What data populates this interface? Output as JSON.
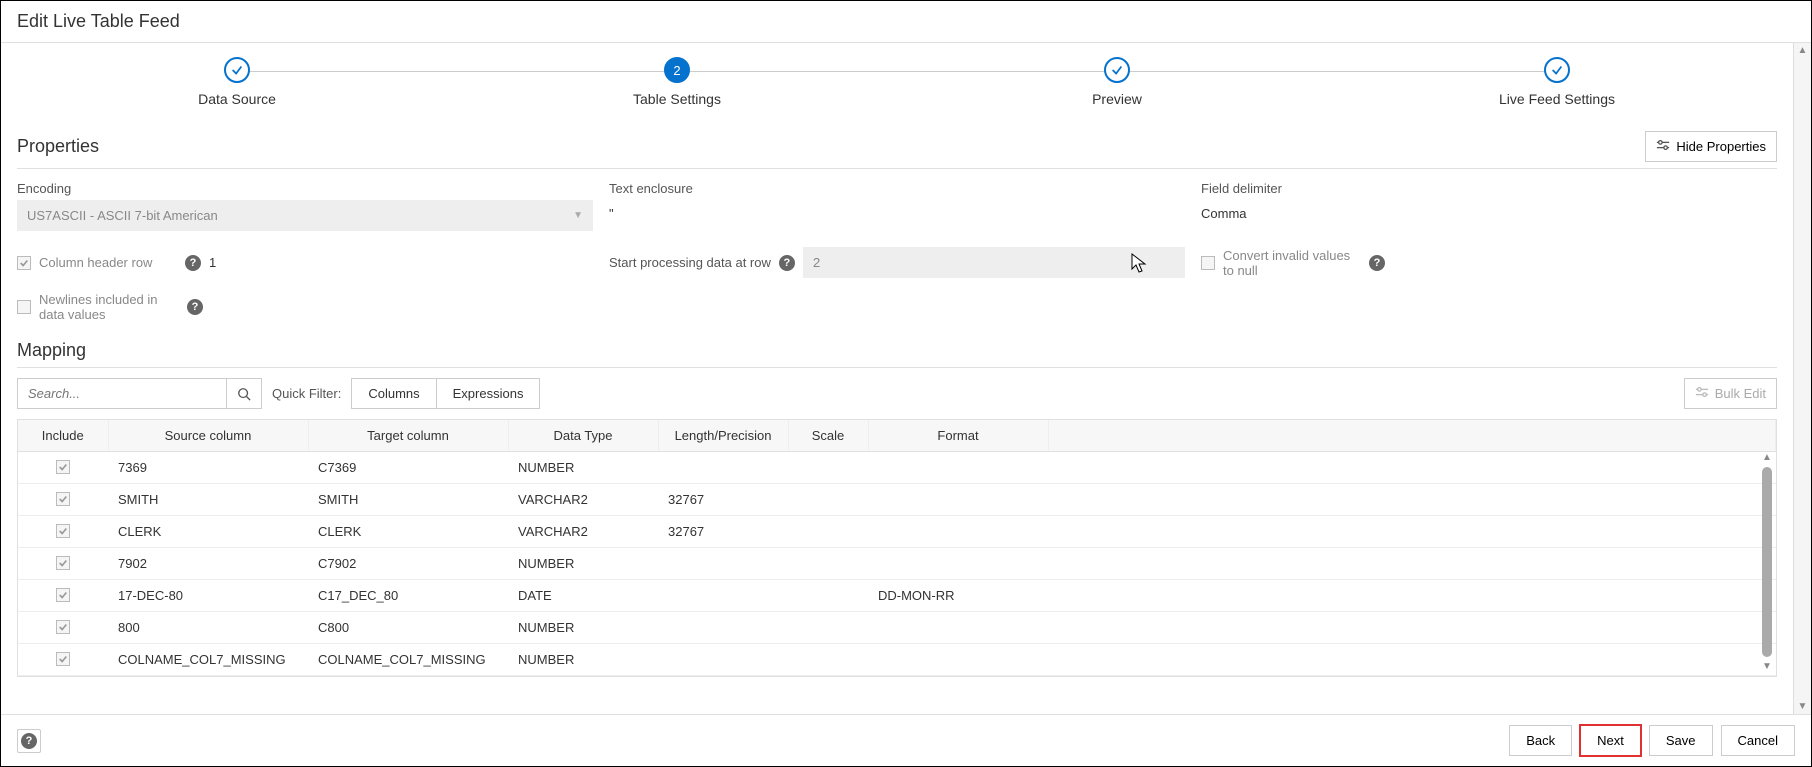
{
  "title": "Edit Live Table Feed",
  "stepper": {
    "steps": [
      {
        "label": "Data Source",
        "state": "done"
      },
      {
        "label": "Table Settings",
        "state": "current",
        "num": "2"
      },
      {
        "label": "Preview",
        "state": "done"
      },
      {
        "label": "Live Feed Settings",
        "state": "done"
      }
    ]
  },
  "properties": {
    "title": "Properties",
    "hide_btn": "Hide Properties",
    "encoding_label": "Encoding",
    "encoding_value": "US7ASCII - ASCII 7-bit American",
    "text_enclosure_label": "Text enclosure",
    "text_enclosure_value": "\"",
    "field_delimiter_label": "Field delimiter",
    "field_delimiter_value": "Comma",
    "column_header_row_label": "Column header row",
    "column_header_row_value": "1",
    "start_row_label": "Start processing data at row",
    "start_row_value": "2",
    "convert_null_label": "Convert invalid values to null",
    "newlines_label": "Newlines included in data values"
  },
  "mapping": {
    "title": "Mapping",
    "search_placeholder": "Search...",
    "quick_filter_label": "Quick Filter:",
    "filter_columns": "Columns",
    "filter_expressions": "Expressions",
    "bulk_edit": "Bulk Edit",
    "headers": {
      "include": "Include",
      "source": "Source column",
      "target": "Target column",
      "dtype": "Data Type",
      "len": "Length/Precision",
      "scale": "Scale",
      "format": "Format"
    },
    "rows": [
      {
        "include": true,
        "source": "7369",
        "target": "C7369",
        "dtype": "NUMBER",
        "len": "",
        "scale": "",
        "format": ""
      },
      {
        "include": true,
        "source": "SMITH",
        "target": "SMITH",
        "dtype": "VARCHAR2",
        "len": "32767",
        "scale": "",
        "format": ""
      },
      {
        "include": true,
        "source": "CLERK",
        "target": "CLERK",
        "dtype": "VARCHAR2",
        "len": "32767",
        "scale": "",
        "format": ""
      },
      {
        "include": true,
        "source": "7902",
        "target": "C7902",
        "dtype": "NUMBER",
        "len": "",
        "scale": "",
        "format": ""
      },
      {
        "include": true,
        "source": "17-DEC-80",
        "target": "C17_DEC_80",
        "dtype": "DATE",
        "len": "",
        "scale": "",
        "format": "DD-MON-RR"
      },
      {
        "include": true,
        "source": "800",
        "target": "C800",
        "dtype": "NUMBER",
        "len": "",
        "scale": "",
        "format": ""
      },
      {
        "include": true,
        "source": "COLNAME_COL7_MISSING",
        "target": "COLNAME_COL7_MISSING",
        "dtype": "NUMBER",
        "len": "",
        "scale": "",
        "format": ""
      }
    ]
  },
  "footer": {
    "back": "Back",
    "next": "Next",
    "save": "Save",
    "cancel": "Cancel"
  }
}
